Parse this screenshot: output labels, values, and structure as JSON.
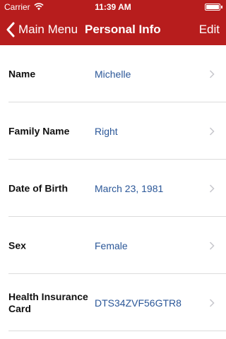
{
  "status_bar": {
    "carrier": "Carrier",
    "time": "11:39 AM",
    "battery_level": 1.0
  },
  "nav": {
    "back_label": "Main Menu",
    "title": "Personal Info",
    "edit_label": "Edit"
  },
  "rows": [
    {
      "label": "Name",
      "value": "Michelle"
    },
    {
      "label": "Family Name",
      "value": "Right"
    },
    {
      "label": "Date of Birth",
      "value": "March 23, 1981"
    },
    {
      "label": "Sex",
      "value": "Female"
    },
    {
      "label": "Health Insurance Card",
      "value": "DTS34ZVF56GTR8"
    }
  ],
  "colors": {
    "nav_background": "#b71d1d",
    "value_text": "#2b5798",
    "separator": "#dcdcdc"
  },
  "icons": [
    "wifi-icon",
    "battery-icon",
    "chevron-left-icon",
    "chevron-right-icon"
  ]
}
